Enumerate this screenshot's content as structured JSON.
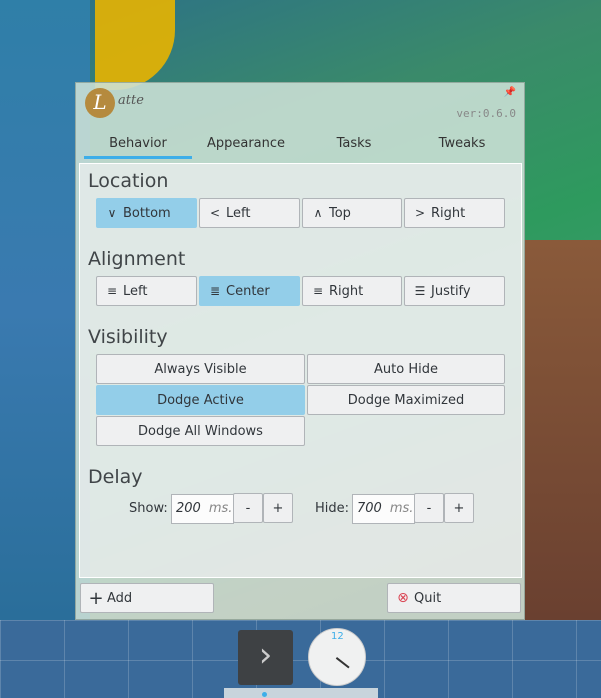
{
  "header": {
    "logo_letter": "L",
    "logo_text": "atte",
    "version": "ver:0.6.0",
    "pin_icon": "pin-icon"
  },
  "tabs": [
    {
      "label": "Behavior",
      "active": true
    },
    {
      "label": "Appearance"
    },
    {
      "label": "Tasks"
    },
    {
      "label": "Tweaks"
    }
  ],
  "location": {
    "title": "Location",
    "options": [
      {
        "label": "Bottom",
        "icon": "chevron-down",
        "selected": true
      },
      {
        "label": "Left",
        "icon": "chevron-left"
      },
      {
        "label": "Top",
        "icon": "chevron-up"
      },
      {
        "label": "Right",
        "icon": "chevron-right"
      }
    ]
  },
  "alignment": {
    "title": "Alignment",
    "options": [
      {
        "label": "Left",
        "icon": "align-left"
      },
      {
        "label": "Center",
        "icon": "align-center",
        "selected": true
      },
      {
        "label": "Right",
        "icon": "align-right"
      },
      {
        "label": "Justify",
        "icon": "align-justify"
      }
    ]
  },
  "visibility": {
    "title": "Visibility",
    "options": [
      {
        "label": "Always Visible"
      },
      {
        "label": "Auto Hide"
      },
      {
        "label": "Dodge Active",
        "selected": true
      },
      {
        "label": "Dodge Maximized"
      },
      {
        "label": "Dodge All Windows"
      }
    ]
  },
  "delay": {
    "title": "Delay",
    "show_label": "Show:",
    "show_value": "200",
    "hide_label": "Hide:",
    "hide_value": "700",
    "unit": "ms.",
    "minus": "-",
    "plus": "+"
  },
  "footer": {
    "add_label": "Add",
    "quit_label": "Quit"
  },
  "dock": {
    "clock_twelve": "12"
  },
  "colors": {
    "accent": "#3daee9",
    "selected": "#93cee9",
    "quit": "#da4453"
  }
}
